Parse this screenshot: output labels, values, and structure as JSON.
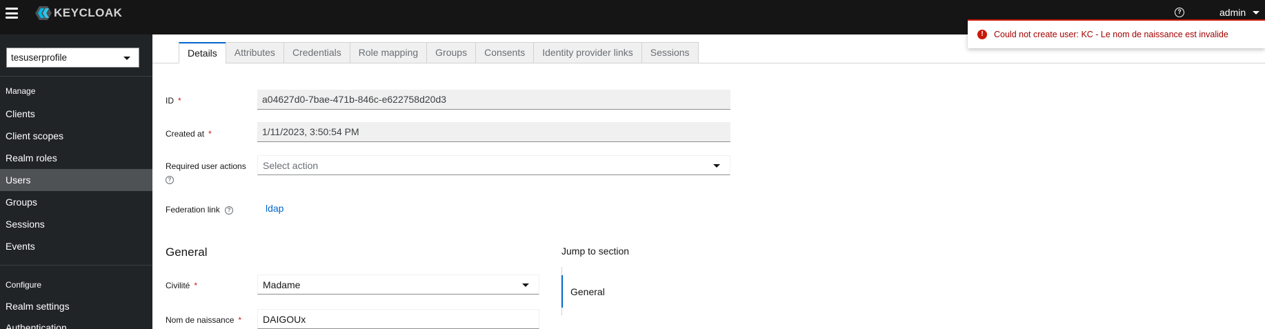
{
  "masthead": {
    "logo_text": "KEYCLOAK",
    "help_icon": "question-circle-icon",
    "user": "admin"
  },
  "sidebar": {
    "realm": "tesuserprofile",
    "sections": [
      {
        "title": "Manage",
        "items": [
          "Clients",
          "Client scopes",
          "Realm roles",
          "Users",
          "Groups",
          "Sessions",
          "Events"
        ]
      },
      {
        "title": "Configure",
        "items": [
          "Realm settings",
          "Authentication"
        ]
      }
    ],
    "active_item": "Users"
  },
  "tabs": [
    "Details",
    "Attributes",
    "Credentials",
    "Role mapping",
    "Groups",
    "Consents",
    "Identity provider links",
    "Sessions"
  ],
  "active_tab": "Details",
  "form": {
    "id_label": "ID",
    "id_value": "a04627d0-7bae-471b-846c-e622758d20d3",
    "created_label": "Created at",
    "created_value": "1/11/2023, 3:50:54 PM",
    "actions_label": "Required user actions",
    "actions_placeholder": "Select action",
    "federation_label": "Federation link",
    "federation_value": "ldap",
    "required_marker": "*"
  },
  "general": {
    "title": "General",
    "jump_title": "Jump to section",
    "jump_item": "General",
    "civilite_label": "Civilité",
    "civilite_value": "Madame",
    "nom_label": "Nom de naissance",
    "nom_value": "DAIGOUx"
  },
  "toast": {
    "message": "Could not create user: KC - Le nom de naissance est invalide",
    "icon": "exclamation-circle-icon",
    "color": "#c9190b"
  },
  "colors": {
    "masthead": "#151515",
    "sidebar": "#212427",
    "accent": "#0066cc",
    "danger": "#c9190b"
  }
}
